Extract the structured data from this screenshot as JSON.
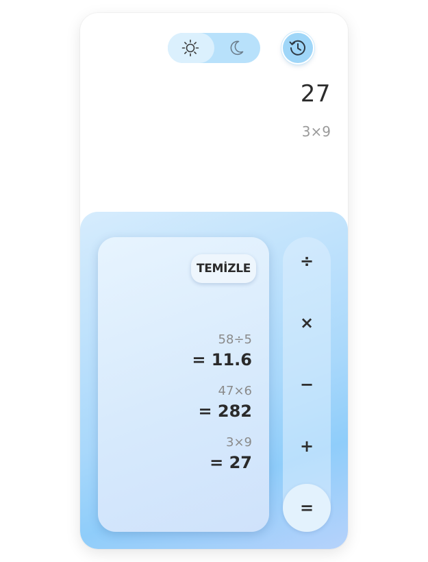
{
  "theme": {
    "modes": [
      "light",
      "dark"
    ],
    "active": "light"
  },
  "display": {
    "value": "27",
    "expression": "3×9"
  },
  "history": {
    "clear_label": "TEMİZLE",
    "entries": [
      {
        "expression": "58÷5",
        "result": "= 11.6"
      },
      {
        "expression": "47×6",
        "result": "= 282"
      },
      {
        "expression": "3×9",
        "result": "= 27"
      }
    ]
  },
  "operators": {
    "divide": "÷",
    "multiply": "×",
    "minus": "−",
    "plus": "+",
    "equals": "="
  },
  "colors": {
    "accent": "#9fd6f8",
    "keypad": "#a9d8fb",
    "text": "#2a2a2a"
  }
}
